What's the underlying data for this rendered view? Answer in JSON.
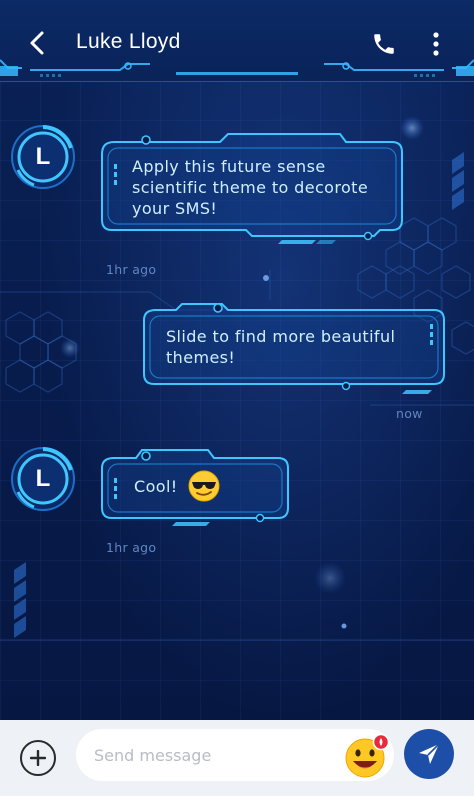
{
  "header": {
    "title": "Luke Lloyd",
    "back_icon": "chevron-left-icon",
    "call_icon": "phone-icon",
    "more_icon": "more-vertical-icon"
  },
  "messages": [
    {
      "direction": "incoming",
      "avatar_letter": "L",
      "lines": [
        "Apply this future sense",
        "scientific theme to decorote",
        "your SMS!"
      ],
      "time": "1hr ago"
    },
    {
      "direction": "outgoing",
      "lines": [
        "Slide to find more beautiful",
        "themes!"
      ],
      "time": "now"
    },
    {
      "direction": "incoming",
      "avatar_letter": "L",
      "lines": [
        "Cool!"
      ],
      "emoji": "smiling-face-with-sunglasses",
      "time": "1hr ago"
    }
  ],
  "composer": {
    "placeholder": "Send message",
    "add_icon": "plus-circle-icon",
    "emoji_icon": "emoji-face-icon",
    "send_icon": "send-icon"
  },
  "colors": {
    "background": "#081c4c",
    "neon": "#3fc6ff",
    "bubble_text": "#cfefff",
    "timestamp": "#5f86c2",
    "send_button": "#1e4fa8",
    "composer_bar": "#eef1f6"
  }
}
